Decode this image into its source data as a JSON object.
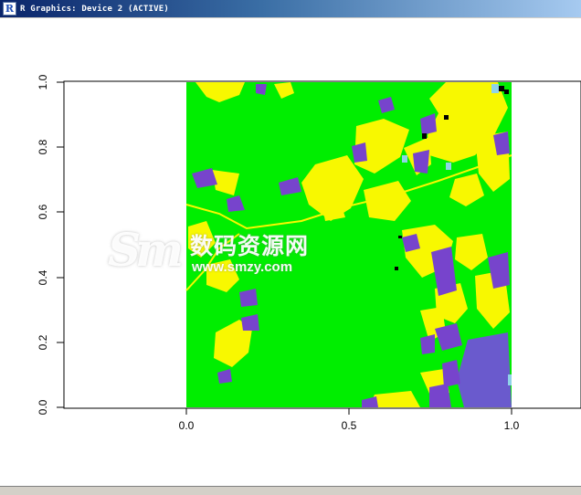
{
  "window": {
    "title": "R Graphics: Device 2 (ACTIVE)",
    "app_icon_letter": "R"
  },
  "plot": {
    "type": "raster-map",
    "x_ticks": [
      "0.0",
      "0.5",
      "1.0"
    ],
    "y_ticks": [
      "0.0",
      "0.2",
      "0.4",
      "0.6",
      "0.8",
      "1.0"
    ],
    "xlim": [
      0,
      1
    ],
    "ylim": [
      0,
      1
    ],
    "colors": {
      "background": "#00ee00",
      "yellow": "#f8f800",
      "purple": "#7744cc",
      "slate": "#6a5acd",
      "black": "#000000",
      "lightblue": "#8fd3e8"
    }
  },
  "watermark": {
    "logo": "Sm",
    "chinese": "数码资源网",
    "url": "www.smzy.com"
  }
}
